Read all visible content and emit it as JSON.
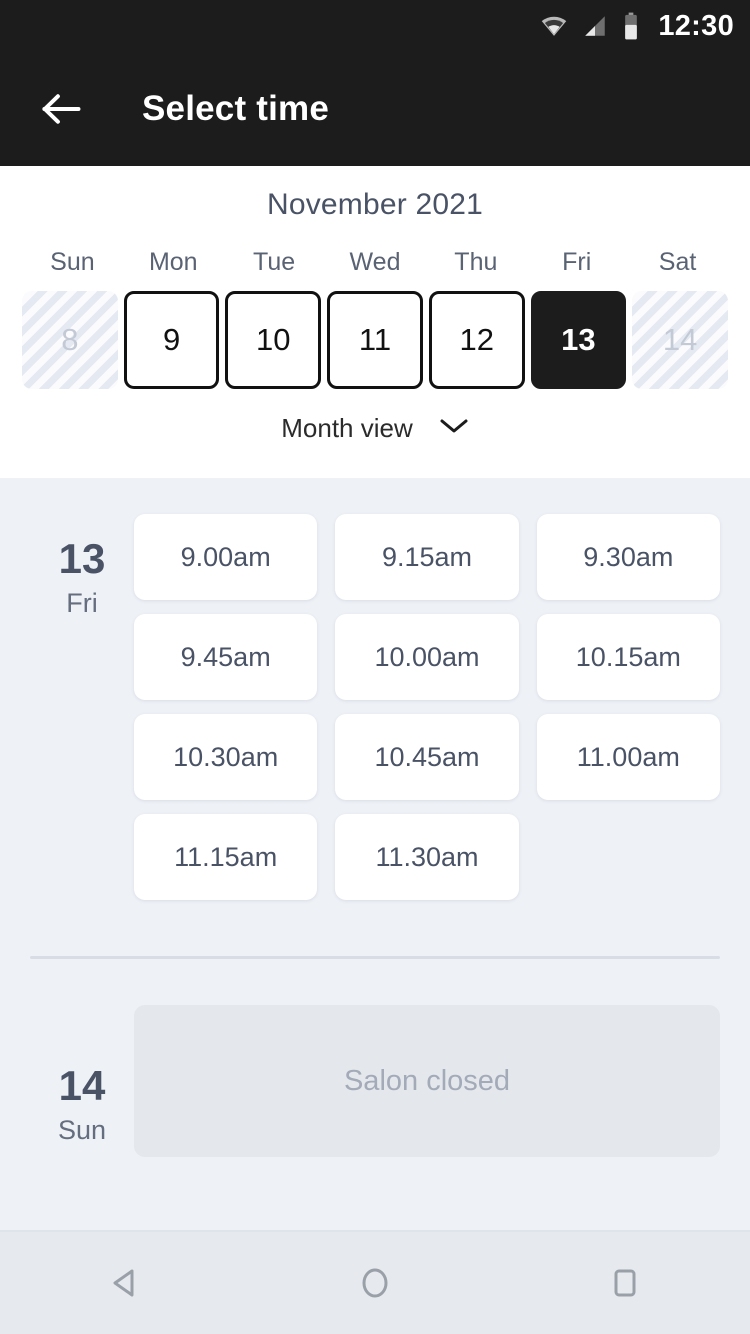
{
  "status_bar": {
    "time": "12:30",
    "icons": [
      "wifi-icon",
      "cellular-signal-icon",
      "battery-icon"
    ]
  },
  "app_bar": {
    "back_icon": "arrow-left-icon",
    "title": "Select time"
  },
  "calendar": {
    "month_title": "November 2021",
    "weekdays": [
      "Sun",
      "Mon",
      "Tue",
      "Wed",
      "Thu",
      "Fri",
      "Sat"
    ],
    "dates": [
      {
        "day": "8",
        "state": "disabled"
      },
      {
        "day": "9",
        "state": "enabled"
      },
      {
        "day": "10",
        "state": "enabled"
      },
      {
        "day": "11",
        "state": "enabled"
      },
      {
        "day": "12",
        "state": "enabled"
      },
      {
        "day": "13",
        "state": "selected"
      },
      {
        "day": "14",
        "state": "disabled"
      }
    ],
    "view_toggle": {
      "label": "Month view",
      "icon": "chevron-down-icon"
    }
  },
  "schedule": {
    "days": [
      {
        "day_number": "13",
        "day_of_week": "Fri",
        "slots": [
          "9.00am",
          "9.15am",
          "9.30am",
          "9.45am",
          "10.00am",
          "10.15am",
          "10.30am",
          "10.45am",
          "11.00am",
          "11.15am",
          "11.30am"
        ]
      },
      {
        "day_number": "14",
        "day_of_week": "Sun",
        "closed_message": "Salon closed"
      }
    ]
  },
  "nav_bar": {
    "back": "nav-back-icon",
    "home": "nav-home-icon",
    "recents": "nav-recents-icon"
  },
  "colors": {
    "app_bar_bg": "#1c1c1c",
    "selected_date_bg": "#1c1c1c",
    "slot_area_bg": "#eef1f6",
    "text_slate": "#4a5366",
    "muted_text": "#a3aab8"
  }
}
